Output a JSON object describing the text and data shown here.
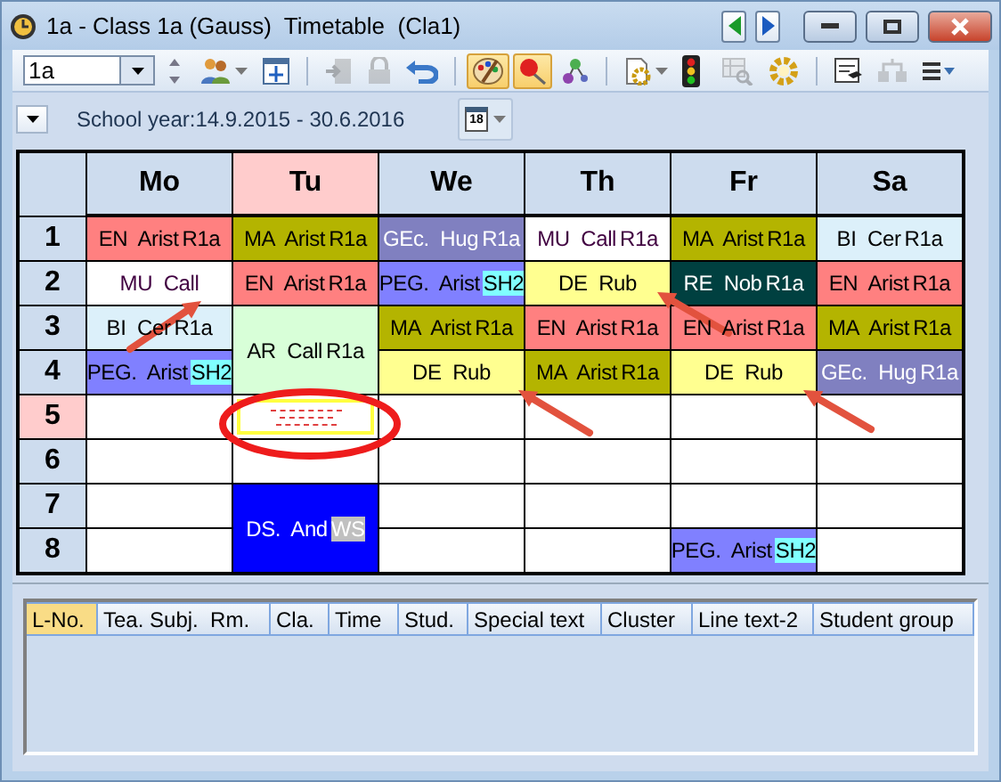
{
  "window": {
    "title": "1a - Class 1a (Gauss)  Timetable  (Cla1)"
  },
  "toolbar": {
    "class_select": {
      "value": "1a"
    },
    "tools": [
      {
        "kind": "people",
        "pressed": false,
        "disabled": false
      },
      {
        "kind": "move-window",
        "pressed": false,
        "disabled": false
      },
      {
        "kind": "separator"
      },
      {
        "kind": "door",
        "pressed": false,
        "disabled": true
      },
      {
        "kind": "lock",
        "pressed": false,
        "disabled": true
      },
      {
        "kind": "undo",
        "pressed": false,
        "disabled": false
      },
      {
        "kind": "separator"
      },
      {
        "kind": "palette",
        "pressed": true,
        "disabled": false
      },
      {
        "kind": "pin",
        "pressed": true,
        "disabled": false
      },
      {
        "kind": "nodes",
        "pressed": false,
        "disabled": false
      },
      {
        "kind": "separator"
      },
      {
        "kind": "doc-gear",
        "pressed": false,
        "disabled": false
      },
      {
        "kind": "traffic-light",
        "pressed": false,
        "disabled": false
      },
      {
        "kind": "table-search",
        "pressed": false,
        "disabled": true
      },
      {
        "kind": "gear",
        "pressed": false,
        "disabled": false
      },
      {
        "kind": "separator"
      },
      {
        "kind": "certificate",
        "pressed": false,
        "disabled": false
      },
      {
        "kind": "network",
        "pressed": false,
        "disabled": true
      },
      {
        "kind": "list-menu",
        "pressed": false,
        "disabled": false
      }
    ]
  },
  "info_bar": {
    "school_year": "School year:14.9.2015 - 30.6.2016",
    "calendar_day": "18"
  },
  "timetable": {
    "days": [
      {
        "label": "Mo",
        "selected": false
      },
      {
        "label": "Tu",
        "selected": true
      },
      {
        "label": "We",
        "selected": false
      },
      {
        "label": "Th",
        "selected": false
      },
      {
        "label": "Fr",
        "selected": false
      },
      {
        "label": "Sa",
        "selected": false
      }
    ],
    "periods": [
      {
        "label": "1",
        "selected": false,
        "cells": [
          {
            "kind": "lesson",
            "subject": "EN",
            "teacher": "Arist",
            "room": {
              "label": "R1a"
            },
            "color": "#ff8080",
            "text": {
              "color": "#000000"
            }
          },
          {
            "kind": "lesson",
            "subject": "MA",
            "teacher": "Arist",
            "room": {
              "label": "R1a"
            },
            "color": "#b4b400",
            "text": {
              "color": "#000000"
            }
          },
          {
            "kind": "lesson",
            "subject": "GEc.",
            "teacher": "Hug",
            "room": {
              "label": "R1a"
            },
            "color": "#8080c0",
            "text": {
              "color": "#ffffff"
            }
          },
          {
            "kind": "lesson",
            "subject": "MU",
            "teacher": "Call",
            "room": {
              "label": "R1a"
            },
            "color": "#ffffff",
            "text": {
              "color": "#400040"
            }
          },
          {
            "kind": "lesson",
            "subject": "MA",
            "teacher": "Arist",
            "room": {
              "label": "R1a"
            },
            "color": "#b4b400",
            "text": {
              "color": "#000000"
            }
          },
          {
            "kind": "lesson",
            "subject": "BI",
            "teacher": "Cer",
            "room": {
              "label": "R1a"
            },
            "color": "#dcf0fa",
            "text": {
              "color": "#000000"
            }
          }
        ]
      },
      {
        "label": "2",
        "selected": false,
        "cells": [
          {
            "kind": "lesson",
            "subject": "MU",
            "teacher": "Call",
            "color": "#ffffff",
            "text": {
              "color": "#400040"
            }
          },
          {
            "kind": "lesson",
            "subject": "EN",
            "teacher": "Arist",
            "room": {
              "label": "R1a"
            },
            "color": "#ff8080",
            "text": {
              "color": "#000000"
            }
          },
          {
            "kind": "lesson",
            "subject": "PEG.",
            "teacher": "Arist",
            "room": {
              "label": "SH2",
              "color": "#80ffff"
            },
            "color": "#8080ff",
            "text": {
              "color": "#000000"
            }
          },
          {
            "kind": "lesson",
            "subject": "DE",
            "teacher": "Rub",
            "color": "#ffff90",
            "text": {
              "color": "#000000"
            }
          },
          {
            "kind": "lesson",
            "subject": "RE",
            "teacher": "Nob",
            "room": {
              "label": "R1a"
            },
            "color": "#004040",
            "text": {
              "color": "#ffffff"
            }
          },
          {
            "kind": "lesson",
            "subject": "EN",
            "teacher": "Arist",
            "room": {
              "label": "R1a"
            },
            "color": "#ff8080",
            "text": {
              "color": "#000000"
            }
          }
        ]
      },
      {
        "label": "3",
        "selected": false,
        "cells": [
          {
            "kind": "lesson",
            "subject": "BI",
            "teacher": "Cer",
            "room": {
              "label": "R1a"
            },
            "color": "#dcf0fa",
            "text": {
              "color": "#000000"
            }
          },
          {
            "kind": "lesson",
            "subject": "AR",
            "teacher": "Call",
            "room": {
              "label": "R1a"
            },
            "color": "#d8ffd8",
            "text": {
              "color": "#000000"
            }
          },
          {
            "kind": "lesson",
            "subject": "MA",
            "teacher": "Arist",
            "room": {
              "label": "R1a"
            },
            "color": "#b4b400",
            "text": {
              "color": "#000000"
            }
          },
          {
            "kind": "lesson",
            "subject": "EN",
            "teacher": "Arist",
            "room": {
              "label": "R1a"
            },
            "color": "#ff8080",
            "text": {
              "color": "#000000"
            }
          },
          {
            "kind": "lesson",
            "subject": "EN",
            "teacher": "Arist",
            "room": {
              "label": "R1a"
            },
            "color": "#ff8080",
            "text": {
              "color": "#000000"
            }
          },
          {
            "kind": "lesson",
            "subject": "MA",
            "teacher": "Arist",
            "room": {
              "label": "R1a"
            },
            "color": "#b4b400",
            "text": {
              "color": "#000000"
            }
          }
        ]
      },
      {
        "label": "4",
        "selected": false,
        "cells": [
          {
            "kind": "lesson",
            "subject": "PEG.",
            "teacher": "Arist",
            "room": {
              "label": "SH2",
              "color": "#80ffff"
            },
            "color": "#8080ff",
            "text": {
              "color": "#000000"
            }
          },
          {
            "kind": "continued"
          },
          {
            "kind": "lesson",
            "subject": "DE",
            "teacher": "Rub",
            "color": "#ffff90",
            "text": {
              "color": "#000000"
            }
          },
          {
            "kind": "lesson",
            "subject": "MA",
            "teacher": "Arist",
            "room": {
              "label": "R1a"
            },
            "color": "#b4b400",
            "text": {
              "color": "#000000"
            }
          },
          {
            "kind": "lesson",
            "subject": "DE",
            "teacher": "Rub",
            "color": "#ffff90",
            "text": {
              "color": "#000000"
            }
          },
          {
            "kind": "lesson",
            "subject": "GEc.",
            "teacher": "Hug",
            "room": {
              "label": "R1a"
            },
            "color": "#8080c0",
            "text": {
              "color": "#ffffff"
            }
          }
        ]
      },
      {
        "label": "5",
        "selected": true,
        "cells": [
          {
            "kind": "empty"
          },
          {
            "kind": "marker"
          },
          {
            "kind": "empty"
          },
          {
            "kind": "empty"
          },
          {
            "kind": "empty"
          },
          {
            "kind": "empty"
          }
        ]
      },
      {
        "label": "6",
        "selected": false,
        "cells": [
          {
            "kind": "empty"
          },
          {
            "kind": "empty"
          },
          {
            "kind": "empty"
          },
          {
            "kind": "empty"
          },
          {
            "kind": "empty"
          },
          {
            "kind": "empty"
          }
        ]
      },
      {
        "label": "7",
        "selected": false,
        "cells": [
          {
            "kind": "empty"
          },
          {
            "kind": "lesson",
            "subject": "DS.",
            "teacher": "And",
            "room": {
              "label": "WS",
              "color": "#c0c0c0"
            },
            "color": "#0000ff",
            "text": {
              "color": "#ffffff"
            }
          },
          {
            "kind": "empty"
          },
          {
            "kind": "empty"
          },
          {
            "kind": "empty"
          },
          {
            "kind": "empty"
          }
        ]
      },
      {
        "label": "8",
        "selected": false,
        "cells": [
          {
            "kind": "empty"
          },
          {
            "kind": "continued"
          },
          {
            "kind": "empty"
          },
          {
            "kind": "empty"
          },
          {
            "kind": "lesson",
            "subject": "PEG.",
            "teacher": "Arist",
            "room": {
              "label": "SH2",
              "color": "#80ffff"
            },
            "color": "#8080ff",
            "text": {
              "color": "#000000"
            }
          },
          {
            "kind": "empty"
          }
        ]
      }
    ]
  },
  "lesson_table": {
    "columns": [
      {
        "label": "L-No.",
        "selected": true
      },
      {
        "label": "Tea. Subj.  Rm.",
        "selected": false
      },
      {
        "label": "Cla.",
        "selected": false
      },
      {
        "label": "Time",
        "selected": false
      },
      {
        "label": "Stud.",
        "selected": false
      },
      {
        "label": "Special text",
        "selected": false
      },
      {
        "label": "Cluster",
        "selected": false
      },
      {
        "label": "Line text-2",
        "selected": false
      },
      {
        "label": "Student group",
        "selected": false
      }
    ]
  }
}
